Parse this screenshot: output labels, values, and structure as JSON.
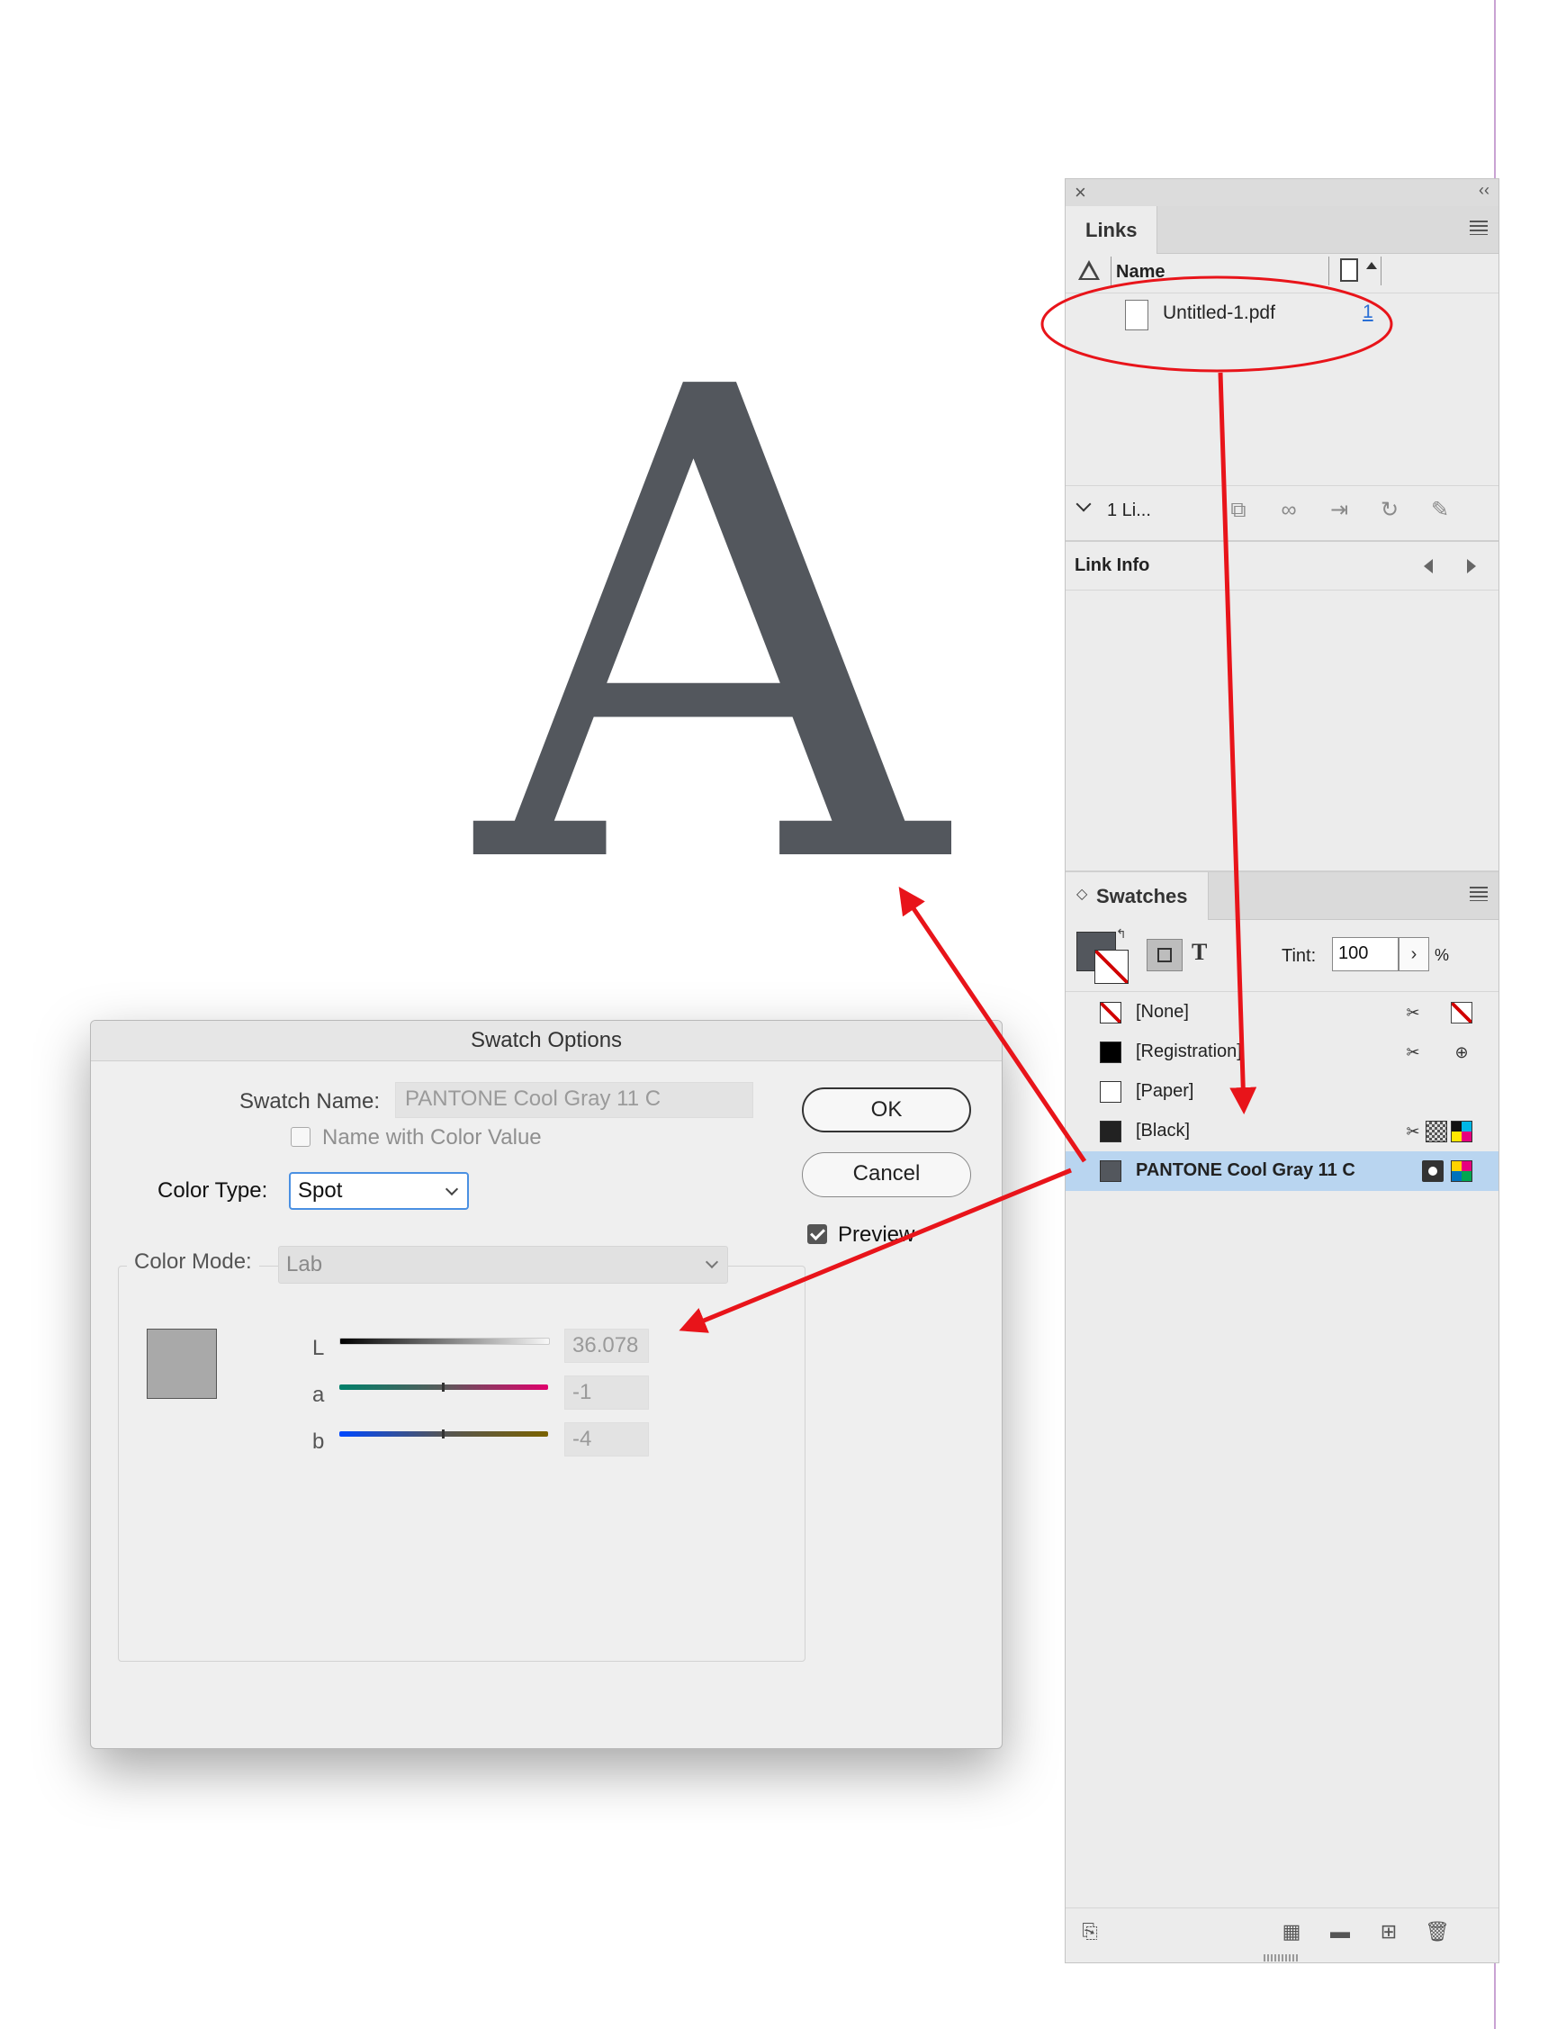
{
  "canvas": {
    "letter": "A",
    "letter_color": "#53575d"
  },
  "links_panel": {
    "tab": "Links",
    "column_name": "Name",
    "items": [
      {
        "name": "Untitled-1.pdf",
        "page": "1"
      }
    ],
    "count_label": "1 Li...",
    "link_info_title": "Link Info"
  },
  "swatches_panel": {
    "tab": "Swatches",
    "tint_label": "Tint:",
    "tint_value": "100",
    "tint_unit": "%",
    "text_button": "T",
    "swatches": [
      {
        "name": "[None]",
        "color": "none",
        "selected": false
      },
      {
        "name": "[Registration]",
        "color": "#000000",
        "selected": false
      },
      {
        "name": "[Paper]",
        "color": "#ffffff",
        "selected": false
      },
      {
        "name": "[Black]",
        "color": "#222222",
        "selected": false
      },
      {
        "name": "PANTONE Cool Gray 11 C",
        "color": "#53575d",
        "selected": true
      }
    ]
  },
  "dialog": {
    "title": "Swatch Options",
    "swatch_name_label": "Swatch Name:",
    "swatch_name_value": "PANTONE Cool Gray 11 C",
    "name_with_value_label": "Name with Color Value",
    "color_type_label": "Color Type:",
    "color_type_value": "Spot",
    "color_mode_label": "Color Mode:",
    "color_mode_value": "Lab",
    "ok_label": "OK",
    "cancel_label": "Cancel",
    "preview_label": "Preview",
    "preview_checked": true,
    "sliders": [
      {
        "label": "L",
        "value": "36.078"
      },
      {
        "label": "a",
        "value": "-1"
      },
      {
        "label": "b",
        "value": "-4"
      }
    ],
    "preview_color": "#a9a9a9"
  },
  "annotation_color": "#e8141a"
}
